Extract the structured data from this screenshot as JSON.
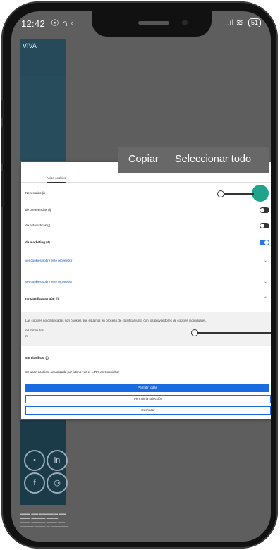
{
  "status_bar": {
    "time": "12:42",
    "left_icons": "☉ ∩ ◦",
    "right_icons": "..ıl ≋",
    "battery": "51"
  },
  "background_page": {
    "logo_text": "VIVA"
  },
  "dialog": {
    "tabs": [
      "",
      "Aviso cookies"
    ],
    "rows": [
      {
        "label": "Necesarias (i)",
        "control": "toggle-disabled"
      },
      {
        "label": "de preferencias (i)",
        "control": "toggle-off"
      },
      {
        "label": "de estadísticas (i)",
        "control": "toggle-off"
      },
      {
        "label": "de marketing (4)",
        "control": "toggle-on"
      },
      {
        "label": "ver cookies sobre este proveedor",
        "control": "chevron"
      },
      {
        "label": "ver cookies sobre este proveedor",
        "control": "chevron"
      },
      {
        "label": "no clasificadas aún (i)",
        "control": "chevron-up"
      }
    ],
    "expanded_lines": [
      "Las cookies no clasificadas son cookies que estamos en proceso de clasificar junto con los proveedores de cookies individuales.",
      "nd 2 minutos",
      "nt"
    ],
    "unclassified_row": "sin clasificar (i)",
    "footer_note": "Se usan cookies, actualizada por última vez el 14/07 en Cookiebot",
    "buttons": {
      "allow_all": "Permitir todas",
      "allow_selection": "Permitir la selección",
      "deny": "Rechazar"
    }
  },
  "text_selection_popup": {
    "copy": "Copiar",
    "select_all": "Seleccionar todo"
  }
}
